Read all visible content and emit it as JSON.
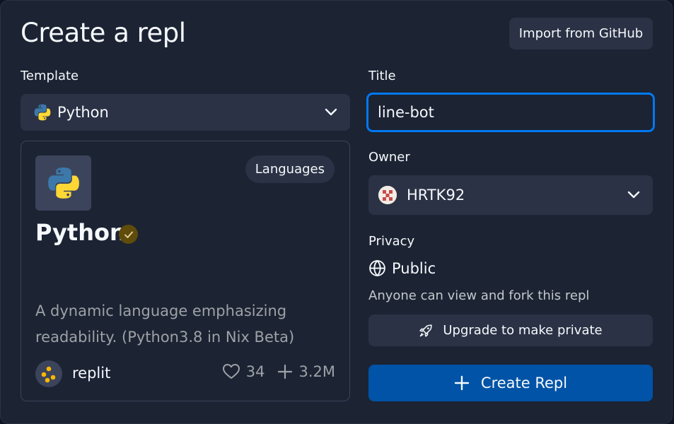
{
  "header": {
    "title": "Create a repl",
    "import_label": "Import from GitHub"
  },
  "template": {
    "label": "Template",
    "selected": "Python",
    "icon": "python-icon"
  },
  "card": {
    "name": "Python",
    "badge": "Languages",
    "verified": true,
    "description": "A dynamic language emphasizing readability. (Python3.8 in Nix Beta)",
    "author": "replit",
    "likes": "34",
    "forks": "3.2M"
  },
  "title_field": {
    "label": "Title",
    "value": "line-bot"
  },
  "owner": {
    "label": "Owner",
    "selected": "HRTK92"
  },
  "privacy": {
    "label": "Privacy",
    "value": "Public",
    "note": "Anyone can view and fork this repl",
    "upgrade_label": "Upgrade to make private"
  },
  "create": {
    "label": "Create Repl"
  },
  "colors": {
    "background": "#1c2333",
    "surface": "#2b3245",
    "focus": "#0079f2",
    "primary_button": "#0053a6",
    "muted_text": "#9da2a6"
  }
}
